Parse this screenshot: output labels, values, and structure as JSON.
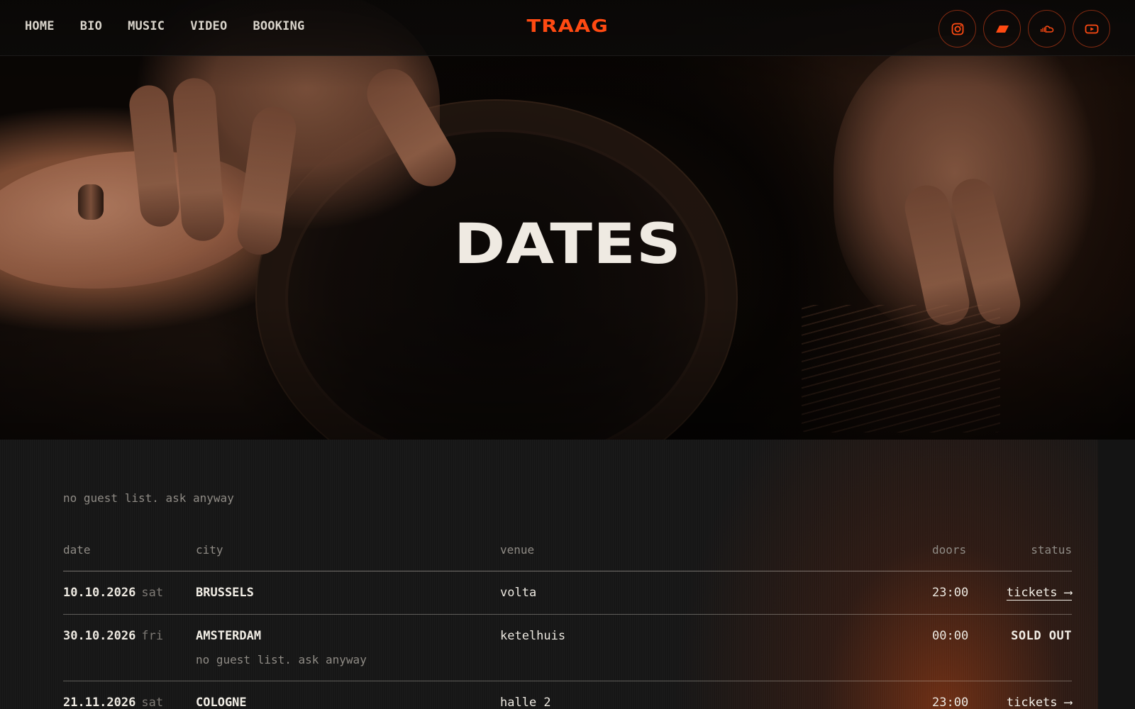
{
  "nav": {
    "links": [
      "HOME",
      "BIO",
      "MUSIC",
      "VIDEO",
      "BOOKING"
    ],
    "logo": "TRAAG",
    "socials": [
      "instagram-icon",
      "bandcamp-icon",
      "soundcloud-icon",
      "youtube-icon"
    ]
  },
  "hero": {
    "title": "DATES"
  },
  "dates": {
    "intro": "no guest list. ask anyway",
    "columns": {
      "date": "date",
      "city": "city",
      "venue": "venue",
      "doors": "doors",
      "status": "status"
    },
    "rows": [
      {
        "date": "10.10.2026",
        "day": "sat",
        "city": "BRUSSELS",
        "venue": "volta",
        "doors": "23:00",
        "status": "tickets ⟶",
        "note": ""
      },
      {
        "date": "30.10.2026",
        "day": "fri",
        "city": "AMSTERDAM",
        "venue": "ketelhuis",
        "doors": "00:00",
        "status": "SOLD OUT",
        "note": "no guest list. ask anyway"
      },
      {
        "date": "21.11.2026",
        "day": "sat",
        "city": "COLOGNE",
        "venue": "halle 2",
        "doors": "23:00",
        "status": "tickets ⟶",
        "note": ""
      }
    ]
  },
  "colors": {
    "accent": "#ff4a12",
    "background": "#141414",
    "text": "#e8e4dc",
    "muted": "#8f8b85"
  }
}
